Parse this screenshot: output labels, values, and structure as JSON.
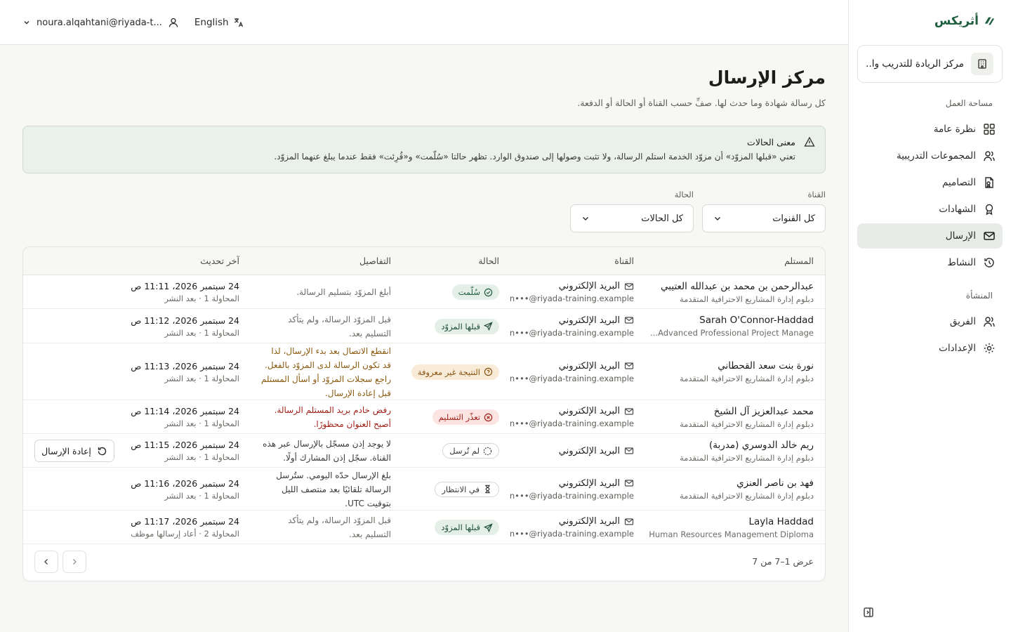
{
  "brand": {
    "name": "أثريكس"
  },
  "org": {
    "name": "مركز الريادة للتدريب وا..."
  },
  "nav": {
    "workspace_label": "مساحة العمل",
    "workspace_items": [
      {
        "label": "نظرة عامة",
        "icon": "grid-icon"
      },
      {
        "label": "المجموعات التدريبية",
        "icon": "users-icon"
      },
      {
        "label": "التصاميم",
        "icon": "template-icon"
      },
      {
        "label": "الشهادات",
        "icon": "award-icon"
      },
      {
        "label": "الإرسال",
        "icon": "mail-icon",
        "active": true
      },
      {
        "label": "النشاط",
        "icon": "history-icon"
      }
    ],
    "org_label": "المنشأة",
    "org_items": [
      {
        "label": "الفريق",
        "icon": "user-icon"
      },
      {
        "label": "الإعدادات",
        "icon": "gear-icon"
      }
    ]
  },
  "header": {
    "user_email": "noura.alqahtani@riyada-t...",
    "language": "English"
  },
  "page": {
    "title": "مركز الإرسال",
    "subtitle": "كل رسالة شهادة وما حدث لها. صفِّ حسب القناة أو الحالة أو الدفعة."
  },
  "alert": {
    "title": "معنى الحالات",
    "body": "تعني «قبلها المزوّد» أن مزوّد الخدمة استلم الرسالة، ولا تثبت وصولها إلى صندوق الوارد. تظهر حالتا «سُلّمت» و«قُرِئت» فقط عندما يبلغ عنهما المزوّد."
  },
  "filters": {
    "channel_label": "القناة",
    "channel_value": "كل القنوات",
    "status_label": "الحالة",
    "status_value": "كل الحالات"
  },
  "table": {
    "headers": {
      "recipient": "المستلم",
      "channel": "القناة",
      "status": "الحالة",
      "details": "التفاصيل",
      "updated": "آخر تحديث"
    },
    "rows": [
      {
        "name": "عبدالرحمن بن محمد بن عبدالله العتيبي",
        "program": "دبلوم إدارة المشاريع الاحترافية المتقدمة",
        "channel": "البريد الإلكتروني",
        "address": "n•••@riyada-training.example",
        "status": "سُلّمت",
        "status_type": "delivered",
        "details": "أبلغ المزوّد بتسليم الرسالة.",
        "date": "24 سبتمبر 2026، 11:11 ص",
        "meta": "المحاولة 1 · بعد النشر"
      },
      {
        "name": "Sarah O'Connor-Haddad",
        "program": "Advanced Professional Project Manage...",
        "channel": "البريد الإلكتروني",
        "address": "n•••@riyada-training.example",
        "status": "قبلها المزوّد",
        "status_type": "accepted",
        "details": "قبل المزوّد الرسالة، ولم يتأكد التسليم بعد.",
        "date": "24 سبتمبر 2026، 11:12 ص",
        "meta": "المحاولة 1 · بعد النشر"
      },
      {
        "name": "نورة بنت سعد القحطاني",
        "program": "دبلوم إدارة المشاريع الاحترافية المتقدمة",
        "channel": "البريد الإلكتروني",
        "address": "n•••@riyada-training.example",
        "status": "النتيجة غير معروفة",
        "status_type": "unknown",
        "details": "انقطع الاتصال بعد بدء الإرسال، لذا قد تكون الرسالة لدى المزوّد بالفعل. راجع سجلات المزوّد أو اسأل المستلم قبل إعادة الإرسال.",
        "date": "24 سبتمبر 2026، 11:13 ص",
        "meta": "المحاولة 1 · بعد النشر"
      },
      {
        "name": "محمد عبدالعزيز آل الشيخ",
        "program": "دبلوم إدارة المشاريع الاحترافية المتقدمة",
        "channel": "البريد الإلكتروني",
        "address": "n•••@riyada-training.example",
        "status": "تعذّر التسليم",
        "status_type": "failed",
        "details": "رفض خادم بريد المستلم الرسالة. أصبح العنوان محظورًا.",
        "date": "24 سبتمبر 2026، 11:14 ص",
        "meta": "المحاولة 1 · بعد النشر"
      },
      {
        "name": "ريم خالد الدوسري (مدربة)",
        "program": "دبلوم إدارة المشاريع الاحترافية المتقدمة",
        "channel": "البريد الإلكتروني",
        "address": "",
        "status": "لم تُرسل",
        "status_type": "notsent",
        "details": "لا يوجد إذن مسجّل بالإرسال عبر هذه القناة. سجّل إذن المشارك أولًا.",
        "date": "24 سبتمبر 2026، 11:15 ص",
        "meta": "المحاولة 1 · بعد النشر",
        "action": "إعادة الإرسال"
      },
      {
        "name": "فهد بن ناصر العنزي",
        "program": "دبلوم إدارة المشاريع الاحترافية المتقدمة",
        "channel": "البريد الإلكتروني",
        "address": "n•••@riyada-training.example",
        "status": "في الانتظار",
        "status_type": "pending",
        "details": "بلغ الإرسال حدّه اليومي. ستُرسل الرسالة تلقائيًا بعد منتصف الليل بتوقيت UTC.",
        "date": "24 سبتمبر 2026، 11:16 ص",
        "meta": "المحاولة 1 · بعد النشر"
      },
      {
        "name": "Layla Haddad",
        "program": "Human Resources Management Diploma",
        "channel": "البريد الإلكتروني",
        "address": "n•••@riyada-training.example",
        "status": "قبلها المزوّد",
        "status_type": "accepted",
        "details": "قبل المزوّد الرسالة، ولم يتأكد التسليم بعد.",
        "date": "24 سبتمبر 2026، 11:17 ص",
        "meta": "المحاولة 2 · أعاد إرسالها موظف"
      }
    ],
    "footer": {
      "count": "عرض 1–7 من 7"
    }
  },
  "colors": {
    "accent": "#1f5e3f",
    "warning": "#8a5210",
    "error": "#a1221a"
  }
}
